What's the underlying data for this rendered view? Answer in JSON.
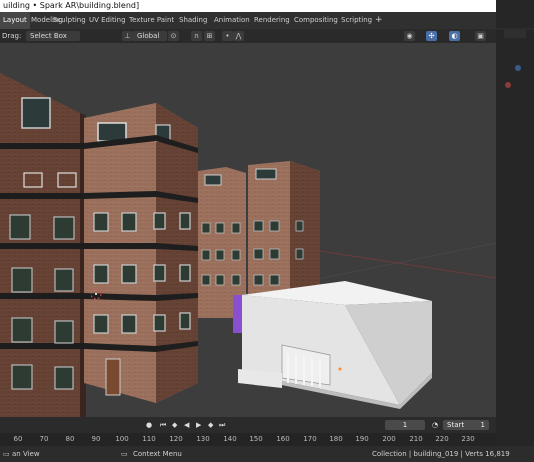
{
  "window": {
    "title": "uilding • Spark AR\\building.blend]"
  },
  "workspaces": [
    "Layout",
    "Modeling",
    "Sculpting",
    "UV Editing",
    "Texture Paint",
    "Shading",
    "Animation",
    "Rendering",
    "Compositing",
    "Scripting"
  ],
  "active_workspace": "Layout",
  "add_tab": "+",
  "header": {
    "drag_label": "Drag:",
    "select_mode": "Select Box",
    "orientation": "Global"
  },
  "timeline": {
    "current_frame": "1",
    "start_label": "Start",
    "start_value": "1"
  },
  "ruler_ticks": [
    "60",
    "70",
    "80",
    "90",
    "100",
    "110",
    "120",
    "130",
    "140",
    "150",
    "160",
    "170",
    "180",
    "190",
    "200",
    "210",
    "220",
    "230"
  ],
  "status": {
    "left": "an View",
    "middle": "Context Menu",
    "right": "Collection | building_019 | Verts 16,819"
  },
  "colors": {
    "accent": "#4a6fa6",
    "background": "#3d3d3d",
    "selected_object": "#8a4fd0"
  }
}
